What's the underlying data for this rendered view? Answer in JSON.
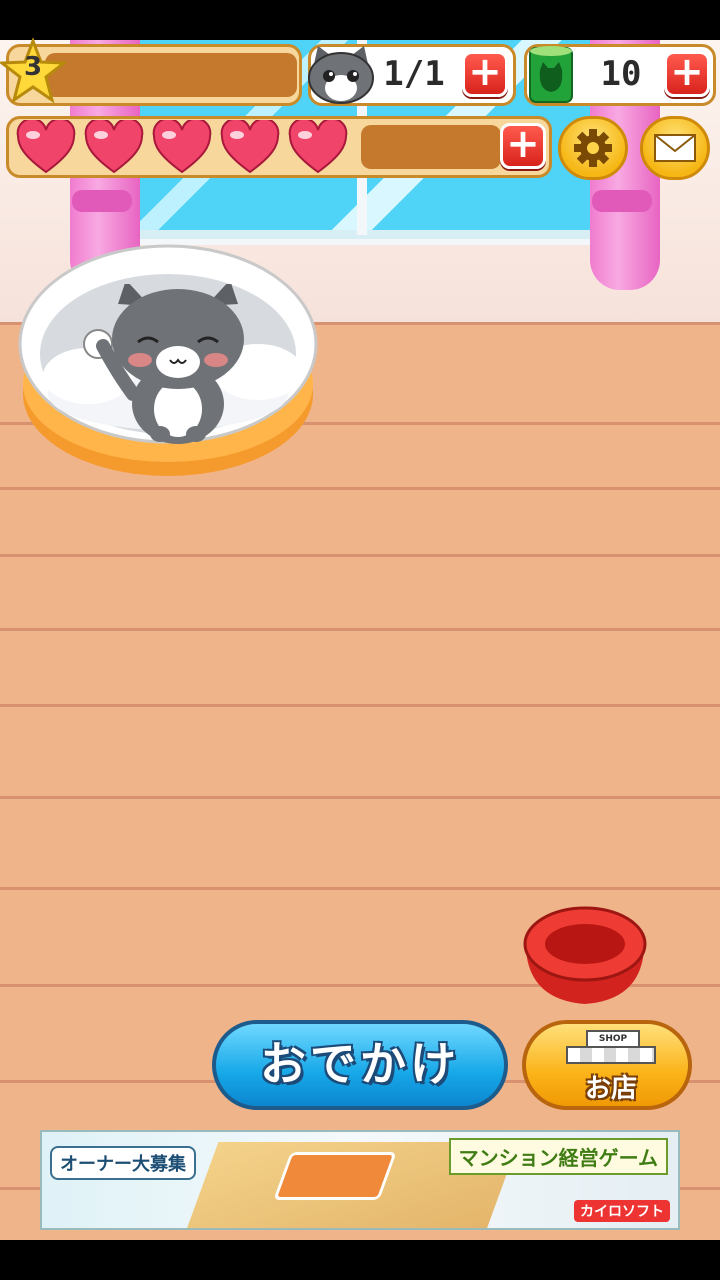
{
  "hud": {
    "level": "3",
    "cats_count": "1/1",
    "cans_count": "10",
    "hearts_filled": 5,
    "plus_label": "+"
  },
  "buttons": {
    "go_out_label": "おでかけ",
    "shop_label": "お店",
    "shop_sign": "SHOP"
  },
  "ad": {
    "tagline": "オーナー大募集",
    "game_title": "マンション経営ゲーム",
    "maker": "カイロソフト"
  },
  "colors": {
    "accent_blue": "#16a8e8",
    "accent_orange": "#fbb319",
    "heart": "#f0446a",
    "floor": "#f0b48a"
  },
  "icons": [
    "star-icon",
    "cat-face-icon",
    "cat-food-can-icon",
    "heart-icon",
    "gear-icon",
    "mail-icon",
    "plus-icon",
    "shop-icon",
    "food-bowl-icon"
  ]
}
